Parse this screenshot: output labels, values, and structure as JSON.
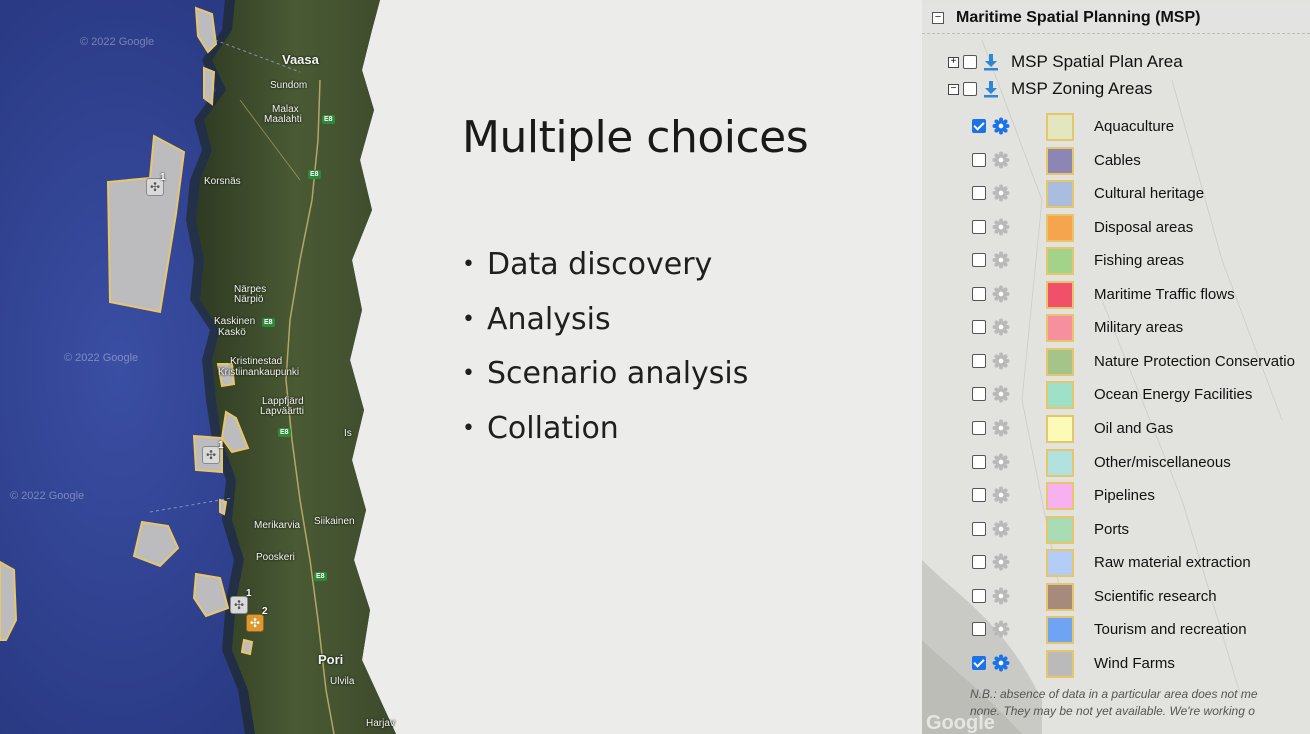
{
  "slide": {
    "title": "Multiple choices",
    "bullets": [
      "Data discovery",
      "Analysis",
      "Scenario analysis",
      "Collation"
    ]
  },
  "map_left": {
    "places": {
      "vaasa": "Vaasa",
      "sundom": "Sundom",
      "malax": "Malax",
      "maalahti": "Maalahti",
      "korsnas": "Korsnäs",
      "narpes": "Närpes",
      "narpio": "Närpiö",
      "kaskinen": "Kaskinen",
      "kasko": "Kaskö",
      "kristinestad": "Kristinestad",
      "kristiinankaupunki": "Kristiinankaupunki",
      "lappfjard": "Lappfjärd",
      "lapvaartti": "Lapväärtti",
      "merikarvia": "Merikarvia",
      "siikainen": "Siikainen",
      "pooskeri": "Pooskeri",
      "pori": "Pori",
      "ulvila": "Ulvila",
      "harjav": "Harjav",
      "is": "Is"
    },
    "road_label": "E8",
    "watermark": "© 2022 Google",
    "clusters": {
      "c1": "1",
      "c2": "1",
      "c3": "1",
      "c4": "2"
    }
  },
  "panel": {
    "title": "Maritime Spatial Planning (MSP)",
    "groups": [
      {
        "label": "MSP Spatial Plan Area",
        "expanded": false
      },
      {
        "label": "MSP Zoning Areas",
        "expanded": true
      }
    ],
    "layers": [
      {
        "label": "Aquaculture",
        "checked": true,
        "color": "#e3e7c0"
      },
      {
        "label": "Cables",
        "checked": false,
        "color": "#8c86b4"
      },
      {
        "label": "Cultural heritage",
        "checked": false,
        "color": "#a9bedf"
      },
      {
        "label": "Disposal areas",
        "checked": false,
        "color": "#f7a44e"
      },
      {
        "label": "Fishing areas",
        "checked": false,
        "color": "#a3d38b"
      },
      {
        "label": "Maritime Traffic flows",
        "checked": false,
        "color": "#f1506a"
      },
      {
        "label": "Military areas",
        "checked": false,
        "color": "#f7909e"
      },
      {
        "label": "Nature Protection Conservatio",
        "checked": false,
        "color": "#a4c48a"
      },
      {
        "label": "Ocean Energy Facilities",
        "checked": false,
        "color": "#9fe0c9"
      },
      {
        "label": "Oil and Gas",
        "checked": false,
        "color": "#fbfbb7"
      },
      {
        "label": "Other/miscellaneous",
        "checked": false,
        "color": "#b2e2df"
      },
      {
        "label": "Pipelines",
        "checked": false,
        "color": "#f7b0f0"
      },
      {
        "label": "Ports",
        "checked": false,
        "color": "#a9dcb4"
      },
      {
        "label": "Raw material extraction",
        "checked": false,
        "color": "#b4cdf7"
      },
      {
        "label": "Scientific research",
        "checked": false,
        "color": "#a68b7c"
      },
      {
        "label": "Tourism and recreation",
        "checked": false,
        "color": "#6fa3f4"
      },
      {
        "label": "Wind Farms",
        "checked": true,
        "color": "#bababa"
      }
    ],
    "note_line1": "N.B.: absence of data in a particular area does not me",
    "note_line2": "none. They may be not yet available. We're working o",
    "google_mark": "Google"
  },
  "colors": {
    "accent_blue": "#1a73e8",
    "zone_outline": "#e7c66a",
    "sea": "#2c3f8e",
    "land": "#3b4a2c"
  }
}
